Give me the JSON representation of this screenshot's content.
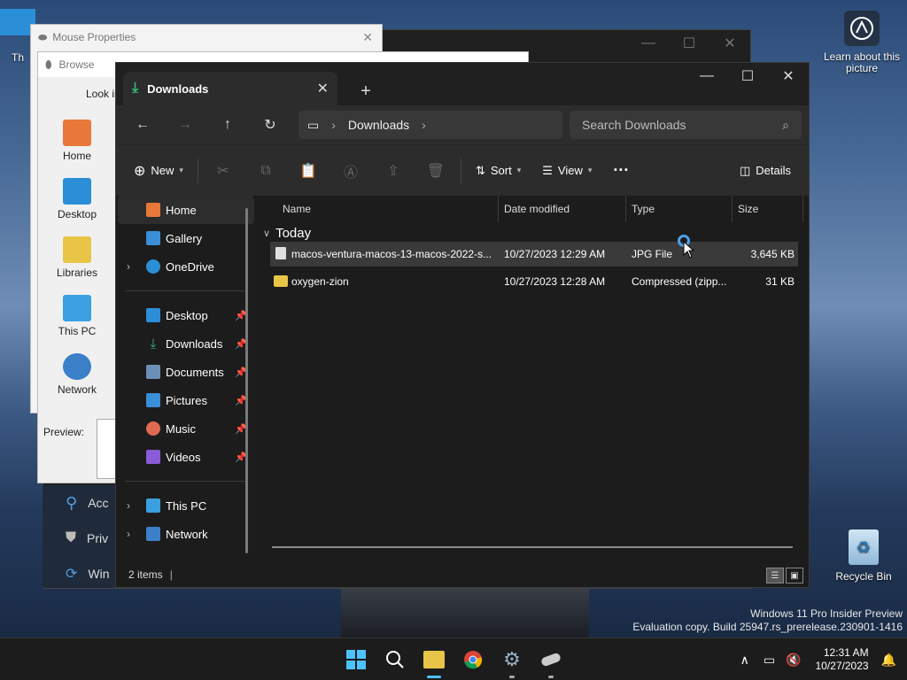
{
  "desktop": {
    "learn_label": "Learn about this picture",
    "recycle_label": "Recycle Bin",
    "partial_icon_label": "Th",
    "watermark_line1": "Windows 11 Pro Insider Preview",
    "watermark_line2": "Evaluation copy. Build 25947.rs_prerelease.230901-1416"
  },
  "mouse_properties": {
    "title": "Mouse Properties"
  },
  "browse_dialog": {
    "title": "Browse",
    "look_in": "Look in",
    "preview_label": "Preview:",
    "side_items": [
      {
        "label": "Home",
        "color": "#e8783a"
      },
      {
        "label": "Desktop",
        "color": "#2b8fd8"
      },
      {
        "label": "Libraries",
        "color": "#e8c547"
      },
      {
        "label": "This PC",
        "color": "#3aa0e0"
      },
      {
        "label": "Network",
        "color": "#3a7fc8"
      }
    ]
  },
  "settings_partial": {
    "items": [
      {
        "label": "Acc",
        "icon": "accessibility-icon"
      },
      {
        "label": "Priv",
        "icon": "shield-icon"
      },
      {
        "label": "Win",
        "icon": "update-icon"
      }
    ]
  },
  "explorer": {
    "tab_title": "Downloads",
    "new_tab": "+",
    "breadcrumb": [
      "Downloads"
    ],
    "search_placeholder": "Search Downloads",
    "cmd": {
      "new_label": "New",
      "sort_label": "Sort",
      "view_label": "View",
      "details_label": "Details"
    },
    "nav": {
      "home": "Home",
      "gallery": "Gallery",
      "onedrive": "OneDrive",
      "pinned": [
        {
          "label": "Desktop",
          "color": "#2b8fd8"
        },
        {
          "label": "Downloads",
          "color": "#3ab878"
        },
        {
          "label": "Documents",
          "color": "#6c8fb8"
        },
        {
          "label": "Pictures",
          "color": "#3a8fd8"
        },
        {
          "label": "Music",
          "color": "#e06a50"
        },
        {
          "label": "Videos",
          "color": "#8a5ad8"
        }
      ],
      "this_pc": "This PC",
      "network": "Network"
    },
    "columns": {
      "name": "Name",
      "date": "Date modified",
      "type": "Type",
      "size": "Size"
    },
    "group": "Today",
    "files": [
      {
        "name": "macos-ventura-macos-13-macos-2022-s...",
        "date": "10/27/2023 12:29 AM",
        "type": "JPG File",
        "size": "3,645 KB",
        "selected": true
      },
      {
        "name": "oxygen-zion",
        "date": "10/27/2023 12:28 AM",
        "type": "Compressed (zipp...",
        "size": "31 KB",
        "selected": false
      }
    ],
    "status": "2 items"
  },
  "taskbar": {
    "time": "12:31 AM",
    "date": "10/27/2023"
  }
}
